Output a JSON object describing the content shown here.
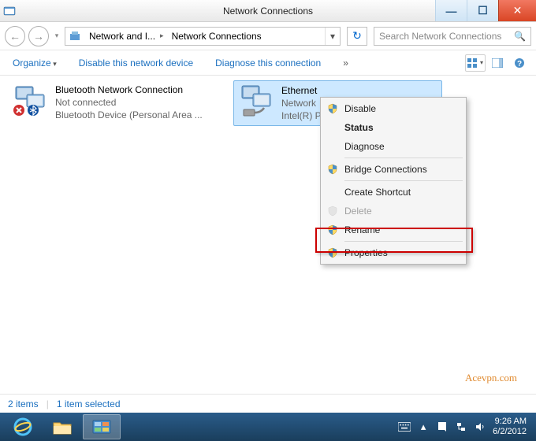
{
  "window": {
    "title": "Network Connections"
  },
  "nav": {
    "breadcrumb1": "Network and I...",
    "breadcrumb2": "Network Connections",
    "search_placeholder": "Search Network Connections"
  },
  "toolbar": {
    "organize": "Organize",
    "disable": "Disable this network device",
    "diagnose": "Diagnose this connection",
    "more": "»"
  },
  "connections": {
    "bluetooth": {
      "name": "Bluetooth Network Connection",
      "status": "Not connected",
      "device": "Bluetooth Device (Personal Area ..."
    },
    "ethernet": {
      "name": "Ethernet",
      "status": "Network",
      "device": "Intel(R) PRO..."
    }
  },
  "context_menu": {
    "disable": "Disable",
    "status": "Status",
    "diagnose": "Diagnose",
    "bridge": "Bridge Connections",
    "shortcut": "Create Shortcut",
    "delete": "Delete",
    "rename": "Rename",
    "properties": "Properties"
  },
  "statusbar": {
    "items": "2 items",
    "selected": "1 item selected"
  },
  "watermark": "Acevpn.com",
  "tray": {
    "time": "9:26 AM",
    "date": "6/2/2012"
  }
}
